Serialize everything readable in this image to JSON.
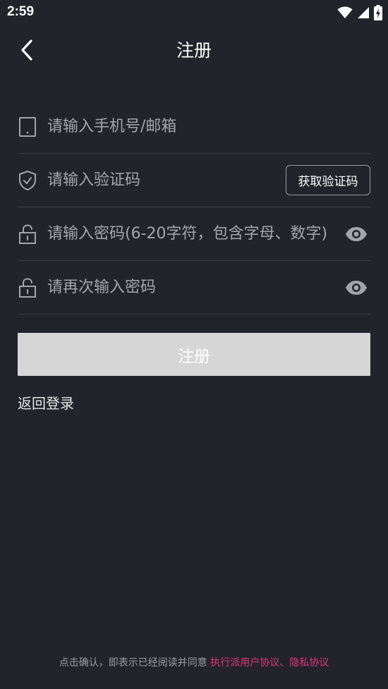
{
  "status_bar": {
    "time": "2:59"
  },
  "header": {
    "title": "注册"
  },
  "form": {
    "account_placeholder": "请输入手机号/邮箱",
    "code_placeholder": "请输入验证码",
    "get_code_label": "获取验证码",
    "password_placeholder": "请输入密码(6-20字符，包含字母、数字)",
    "confirm_password_placeholder": "请再次输入密码"
  },
  "submit_label": "注册",
  "back_to_login_label": "返回登录",
  "footer": {
    "prefix": "点击确认，即表示已经阅读并同意 ",
    "user_agreement": "执行派用户协议",
    "separator": "、",
    "privacy_policy": "隐私协议"
  },
  "colors": {
    "background": "#23232c",
    "submit_button": "#d6d6d6",
    "link": "#e0367a"
  },
  "icons": {
    "back": "chevron-left-icon",
    "phone": "phone-icon",
    "shield": "shield-check-icon",
    "lock": "lock-open-icon",
    "eye": "eye-icon",
    "wifi": "wifi-icon",
    "signal": "signal-icon",
    "battery": "battery-charging-icon"
  }
}
